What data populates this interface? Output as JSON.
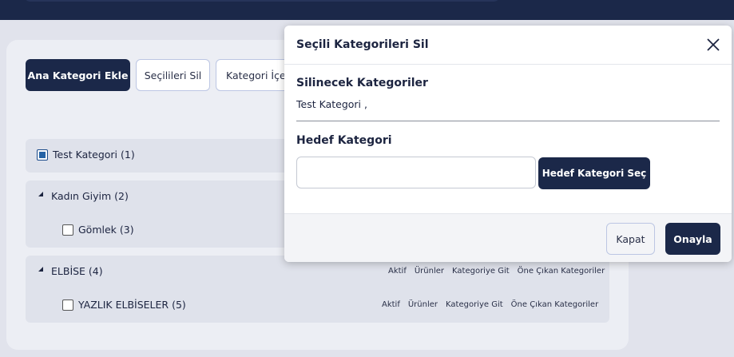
{
  "toolbar": {
    "add_main_category": "Ana Kategori Ekle",
    "delete_selected": "Seçilileri Sil",
    "category_content": "Kategori İçer"
  },
  "categories": [
    {
      "label": "Test Kategori (1)",
      "checked": true
    },
    {
      "label": "Kadın Giyim (2)",
      "children": [
        {
          "label": "Gömlek (3)",
          "checked": false
        }
      ]
    },
    {
      "label": "ELBİSE (4)",
      "children": [
        {
          "label": "YAZLIK ELBİSELER (5)",
          "checked": false
        }
      ]
    }
  ],
  "row_actions": {
    "active": "Aktif",
    "products": "Ürünler",
    "go_to_category": "Kategoriye Git",
    "featured_categories": "Öne Çıkan Kategoriler"
  },
  "modal": {
    "title": "Seçili Kategorileri Sil",
    "deleted_categories_label": "Silinecek Kategoriler",
    "deleted_categories_value": "Test Kategori ,",
    "target_category_label": "Hedef Kategori",
    "target_category_value": "",
    "select_target_button": "Hedef Kategori Seç",
    "close_button": "Kapat",
    "confirm_button": "Onayla"
  },
  "colors": {
    "primary": "#1b2849",
    "background": "#e1e3ec",
    "panel": "#eceef4",
    "row": "#dfe2eb"
  }
}
